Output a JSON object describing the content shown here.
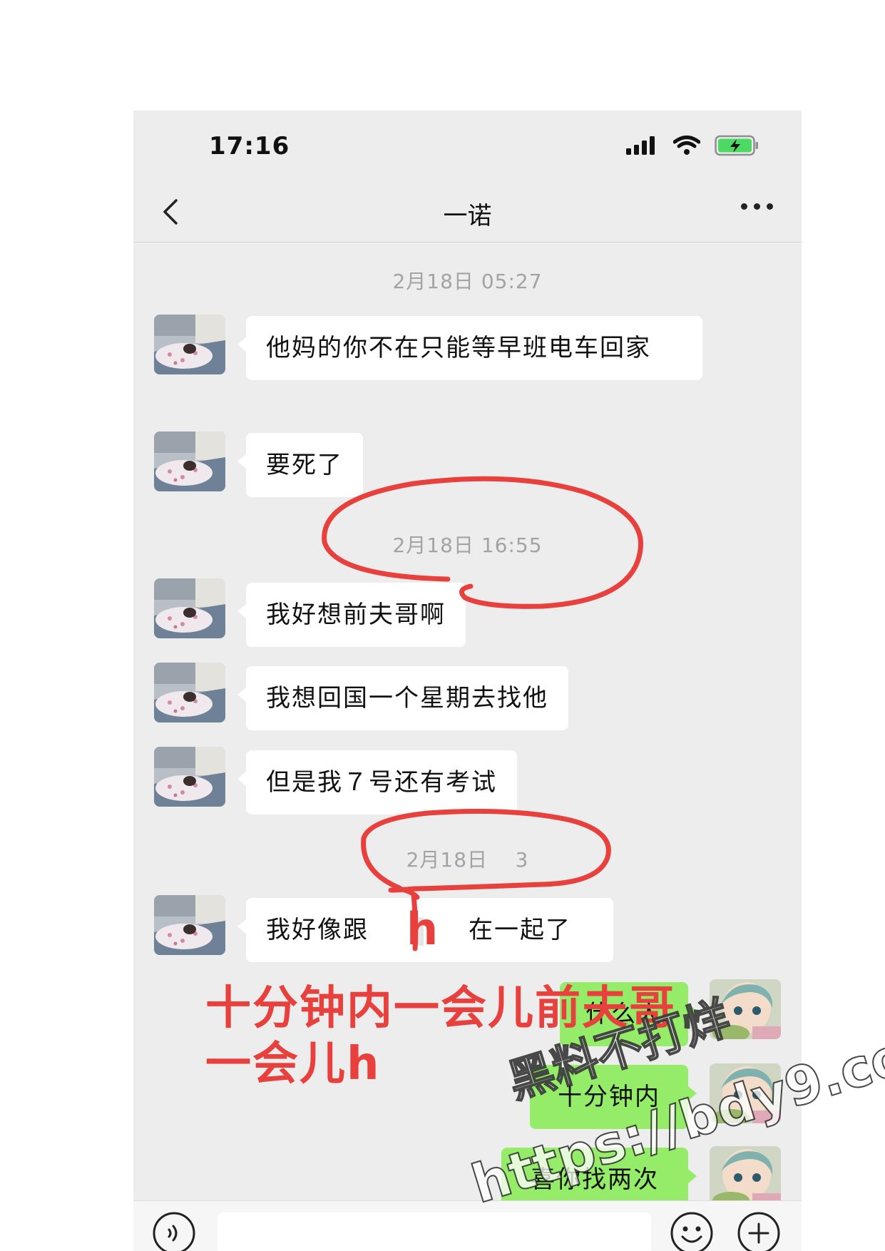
{
  "status_bar": {
    "time": "17:16"
  },
  "nav": {
    "title": "一诺"
  },
  "timestamps": [
    "2月18日 05:27",
    "2月18日 16:55",
    "2月18日 1  3"
  ],
  "messages": [
    {
      "side": "left",
      "text": "他妈的你不在只能等早班电车回家"
    },
    {
      "side": "left",
      "text": "要死了"
    },
    {
      "side": "left",
      "text": "我好想前夫哥啊"
    },
    {
      "side": "left",
      "text": "我想回国一个星期去找他"
    },
    {
      "side": "left",
      "text": "但是我７号还有考试"
    },
    {
      "side": "left",
      "text_start": "我好像跟",
      "text_end": "在一起了"
    },
    {
      "side": "right",
      "text": "什么人"
    },
    {
      "side": "right",
      "text": "十分钟内"
    },
    {
      "side": "right",
      "text": "喜你找两次"
    }
  ],
  "annotations": {
    "handwritten": "h",
    "caption_line1": "十分钟内一会儿前夫哥",
    "caption_line2": "一会儿h"
  },
  "watermark": {
    "line1": "黑料不打烊",
    "line2": "https://bdy9.co"
  },
  "colors": {
    "chat_bg": "#ededed",
    "bubble_in": "#ffffff",
    "bubble_out": "#95ec69",
    "annotation_red": "#e8403d",
    "battery_green": "#4cd964"
  },
  "icons": [
    "signal-icon",
    "wifi-icon",
    "battery-icon",
    "back-icon",
    "more-icon",
    "voice-icon",
    "emoji-icon",
    "plus-icon"
  ]
}
